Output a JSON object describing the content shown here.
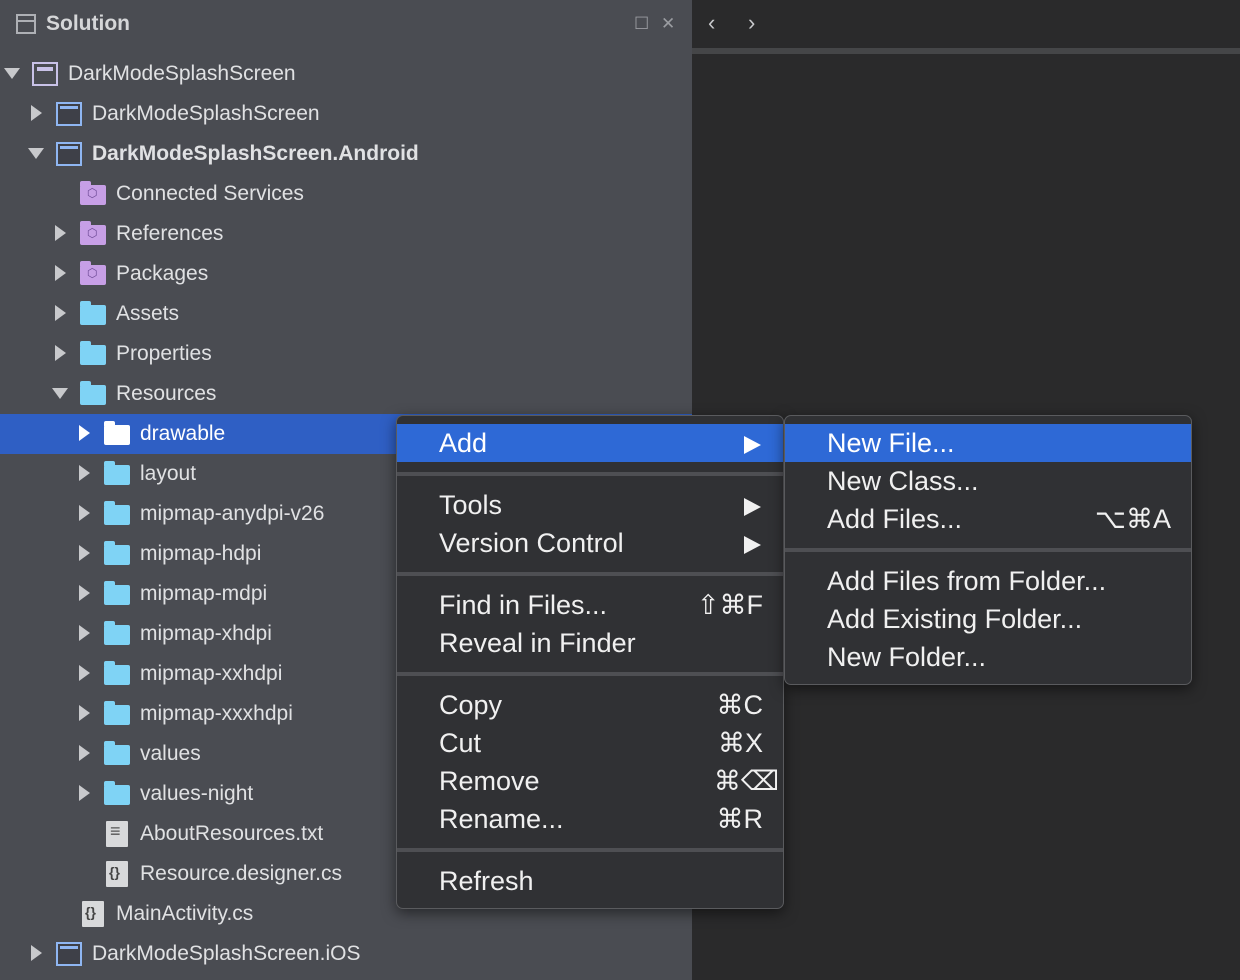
{
  "panel": {
    "title": "Solution"
  },
  "tree": [
    "DarkModeSplashScreen",
    "DarkModeSplashScreen",
    "DarkModeSplashScreen.Android",
    "Connected Services",
    "References",
    "Packages",
    "Assets",
    "Properties",
    "Resources",
    "drawable",
    "layout",
    "mipmap-anydpi-v26",
    "mipmap-hdpi",
    "mipmap-mdpi",
    "mipmap-xhdpi",
    "mipmap-xxhdpi",
    "mipmap-xxxhdpi",
    "values",
    "values-night",
    "AboutResources.txt",
    "Resource.designer.cs",
    "MainActivity.cs",
    "DarkModeSplashScreen.iOS"
  ],
  "context_menu": {
    "add": "Add",
    "tools": "Tools",
    "version_control": "Version Control",
    "find_in_files": "Find in Files...",
    "find_in_files_shortcut": "⇧⌘F",
    "reveal_in_finder": "Reveal in Finder",
    "copy": "Copy",
    "copy_shortcut": "⌘C",
    "cut": "Cut",
    "cut_shortcut": "⌘X",
    "remove": "Remove",
    "remove_shortcut": "⌘⌫",
    "rename": "Rename...",
    "rename_shortcut": "⌘R",
    "refresh": "Refresh"
  },
  "submenu": {
    "new_file": "New File...",
    "new_class": "New Class...",
    "add_files": "Add Files...",
    "add_files_shortcut": "⌥⌘A",
    "add_files_from_folder": "Add Files from Folder...",
    "add_existing_folder": "Add Existing Folder...",
    "new_folder": "New Folder..."
  },
  "colors": {
    "panel_bg": "#4a4c52",
    "selection": "#2f5fc4",
    "menu_highlight": "#2e69d6",
    "folder": "#7fd3f5"
  }
}
